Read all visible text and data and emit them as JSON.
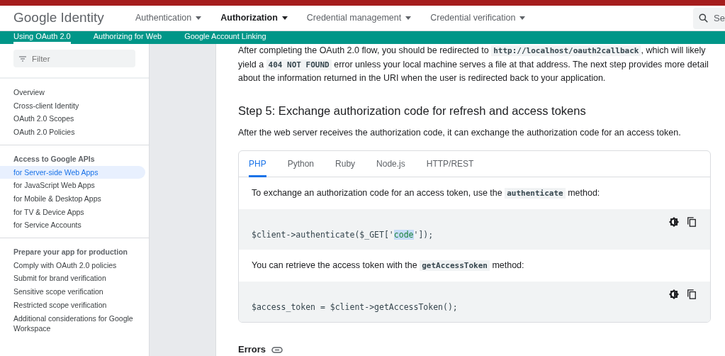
{
  "header": {
    "logo": "Google Identity",
    "nav": [
      {
        "label": "Authentication",
        "selected": false
      },
      {
        "label": "Authorization",
        "selected": true
      },
      {
        "label": "Credential management",
        "selected": false
      },
      {
        "label": "Credential verification",
        "selected": false
      }
    ],
    "search": {
      "placeholder": "Se"
    }
  },
  "subnav": [
    {
      "label": "Using OAuth 2.0",
      "selected": true
    },
    {
      "label": "Authorizing for Web",
      "selected": false
    },
    {
      "label": "Google Account Linking",
      "selected": false
    }
  ],
  "sidebar": {
    "filter": {
      "placeholder": "Filter"
    },
    "sections": [
      {
        "items": [
          {
            "label": "Overview",
            "selected": false
          },
          {
            "label": "Cross-client Identity",
            "selected": false
          },
          {
            "label": "OAuth 2.0 Scopes",
            "selected": false
          },
          {
            "label": "OAuth 2.0 Policies",
            "selected": false
          }
        ]
      },
      {
        "heading": "Access to Google APIs",
        "items": [
          {
            "label": "for Server-side Web Apps",
            "selected": true
          },
          {
            "label": "for JavaScript Web Apps",
            "selected": false
          },
          {
            "label": "for Mobile & Desktop Apps",
            "selected": false
          },
          {
            "label": "for TV & Device Apps",
            "selected": false
          },
          {
            "label": "for Service Accounts",
            "selected": false
          }
        ]
      },
      {
        "heading": "Prepare your app for production",
        "items": [
          {
            "label": "Comply with OAuth 2.0 policies",
            "selected": false
          },
          {
            "label": "Submit for brand verification",
            "selected": false
          },
          {
            "label": "Sensitive scope verification",
            "selected": false
          },
          {
            "label": "Restricted scope verification",
            "selected": false
          },
          {
            "label": "Additional considerations for Google Workspace",
            "selected": false
          }
        ]
      }
    ]
  },
  "content": {
    "intro": [
      {
        "text": "After completing the OAuth 2.0 flow, you should be redirected to "
      },
      {
        "text": "http://localhost/oauth2callback",
        "kind": "code"
      },
      {
        "text": ", which will likely yield a "
      },
      {
        "text": "404 NOT FOUND",
        "kind": "code"
      },
      {
        "text": " error unless your local machine serves a file at that address. The next step provides more detail about the information returned in the URI when the user is redirected back to your application."
      }
    ],
    "heading": "Step 5: Exchange authorization code for refresh and access tokens",
    "lead": "After the web server receives the authorization code, it can exchange the authorization code for an access token.",
    "tabs": [
      {
        "label": "PHP",
        "selected": true
      },
      {
        "label": "Python",
        "selected": false
      },
      {
        "label": "Ruby",
        "selected": false
      },
      {
        "label": "Node.js",
        "selected": false
      },
      {
        "label": "HTTP/REST",
        "selected": false
      }
    ],
    "blocks": [
      {
        "kind": "text",
        "parts": [
          {
            "text": "To exchange an authorization code for an access token, use the "
          },
          {
            "text": "authenticate",
            "kind": "code"
          },
          {
            "text": " method:"
          }
        ]
      },
      {
        "kind": "code",
        "parts": [
          {
            "text": "$client->authenticate($_GET['"
          },
          {
            "text": "code",
            "kind": "string"
          },
          {
            "text": "']);"
          }
        ]
      },
      {
        "kind": "text",
        "parts": [
          {
            "text": "You can retrieve the access token with the "
          },
          {
            "text": "getAccessToken",
            "kind": "code"
          },
          {
            "text": " method:"
          }
        ]
      },
      {
        "kind": "code",
        "parts": [
          {
            "text": "$access_token = $client->getAccessToken();"
          }
        ]
      }
    ],
    "errors_heading": "Errors"
  }
}
